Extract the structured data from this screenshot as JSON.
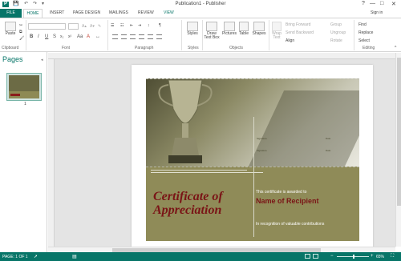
{
  "window": {
    "title": "Publication1 - Publisher",
    "help": "?",
    "minimize": "—",
    "maximize": "□",
    "close": "✕"
  },
  "tabs": {
    "file": "FILE",
    "home": "HOME",
    "insert": "INSERT",
    "page_design": "PAGE DESIGN",
    "mailings": "MAILINGS",
    "review": "REVIEW",
    "view": "VIEW"
  },
  "ribbon": {
    "clipboard": {
      "paste": "Paste",
      "label": "Clipboard"
    },
    "font": {
      "label": "Font",
      "bold": "B",
      "italic": "I",
      "underline": "U"
    },
    "paragraph": {
      "label": "Paragraph"
    },
    "styles": {
      "button": "Styles",
      "label": "Styles"
    },
    "objects": {
      "draw_text_box": "Draw Text Box",
      "pictures": "Pictures",
      "table": "Table",
      "shapes": "Shapes",
      "label": "Objects"
    },
    "arrange": {
      "wrap_text": "Wrap Text",
      "bring_forward": "Bring Forward",
      "send_backward": "Send Backward",
      "align": "Align",
      "group": "Group",
      "ungroup": "Ungroup",
      "rotate": "Rotate"
    },
    "editing": {
      "find": "Find",
      "replace": "Replace",
      "select": "Select",
      "label": "Editing"
    }
  },
  "pages_pane": {
    "title": "Pages",
    "page_number": "1"
  },
  "certificate": {
    "heading": "Certificate of Appreciation",
    "awarded_to": "This certificate is awarded to",
    "recipient": "Name of Recipient",
    "recognition": "In recognition of valuable contributions"
  },
  "status": {
    "page": "PAGE: 1 OF 1",
    "zoom": "65%"
  },
  "colors": {
    "accent": "#077568",
    "certificate_text": "#7a1416",
    "certificate_band": "#8f8b58"
  }
}
